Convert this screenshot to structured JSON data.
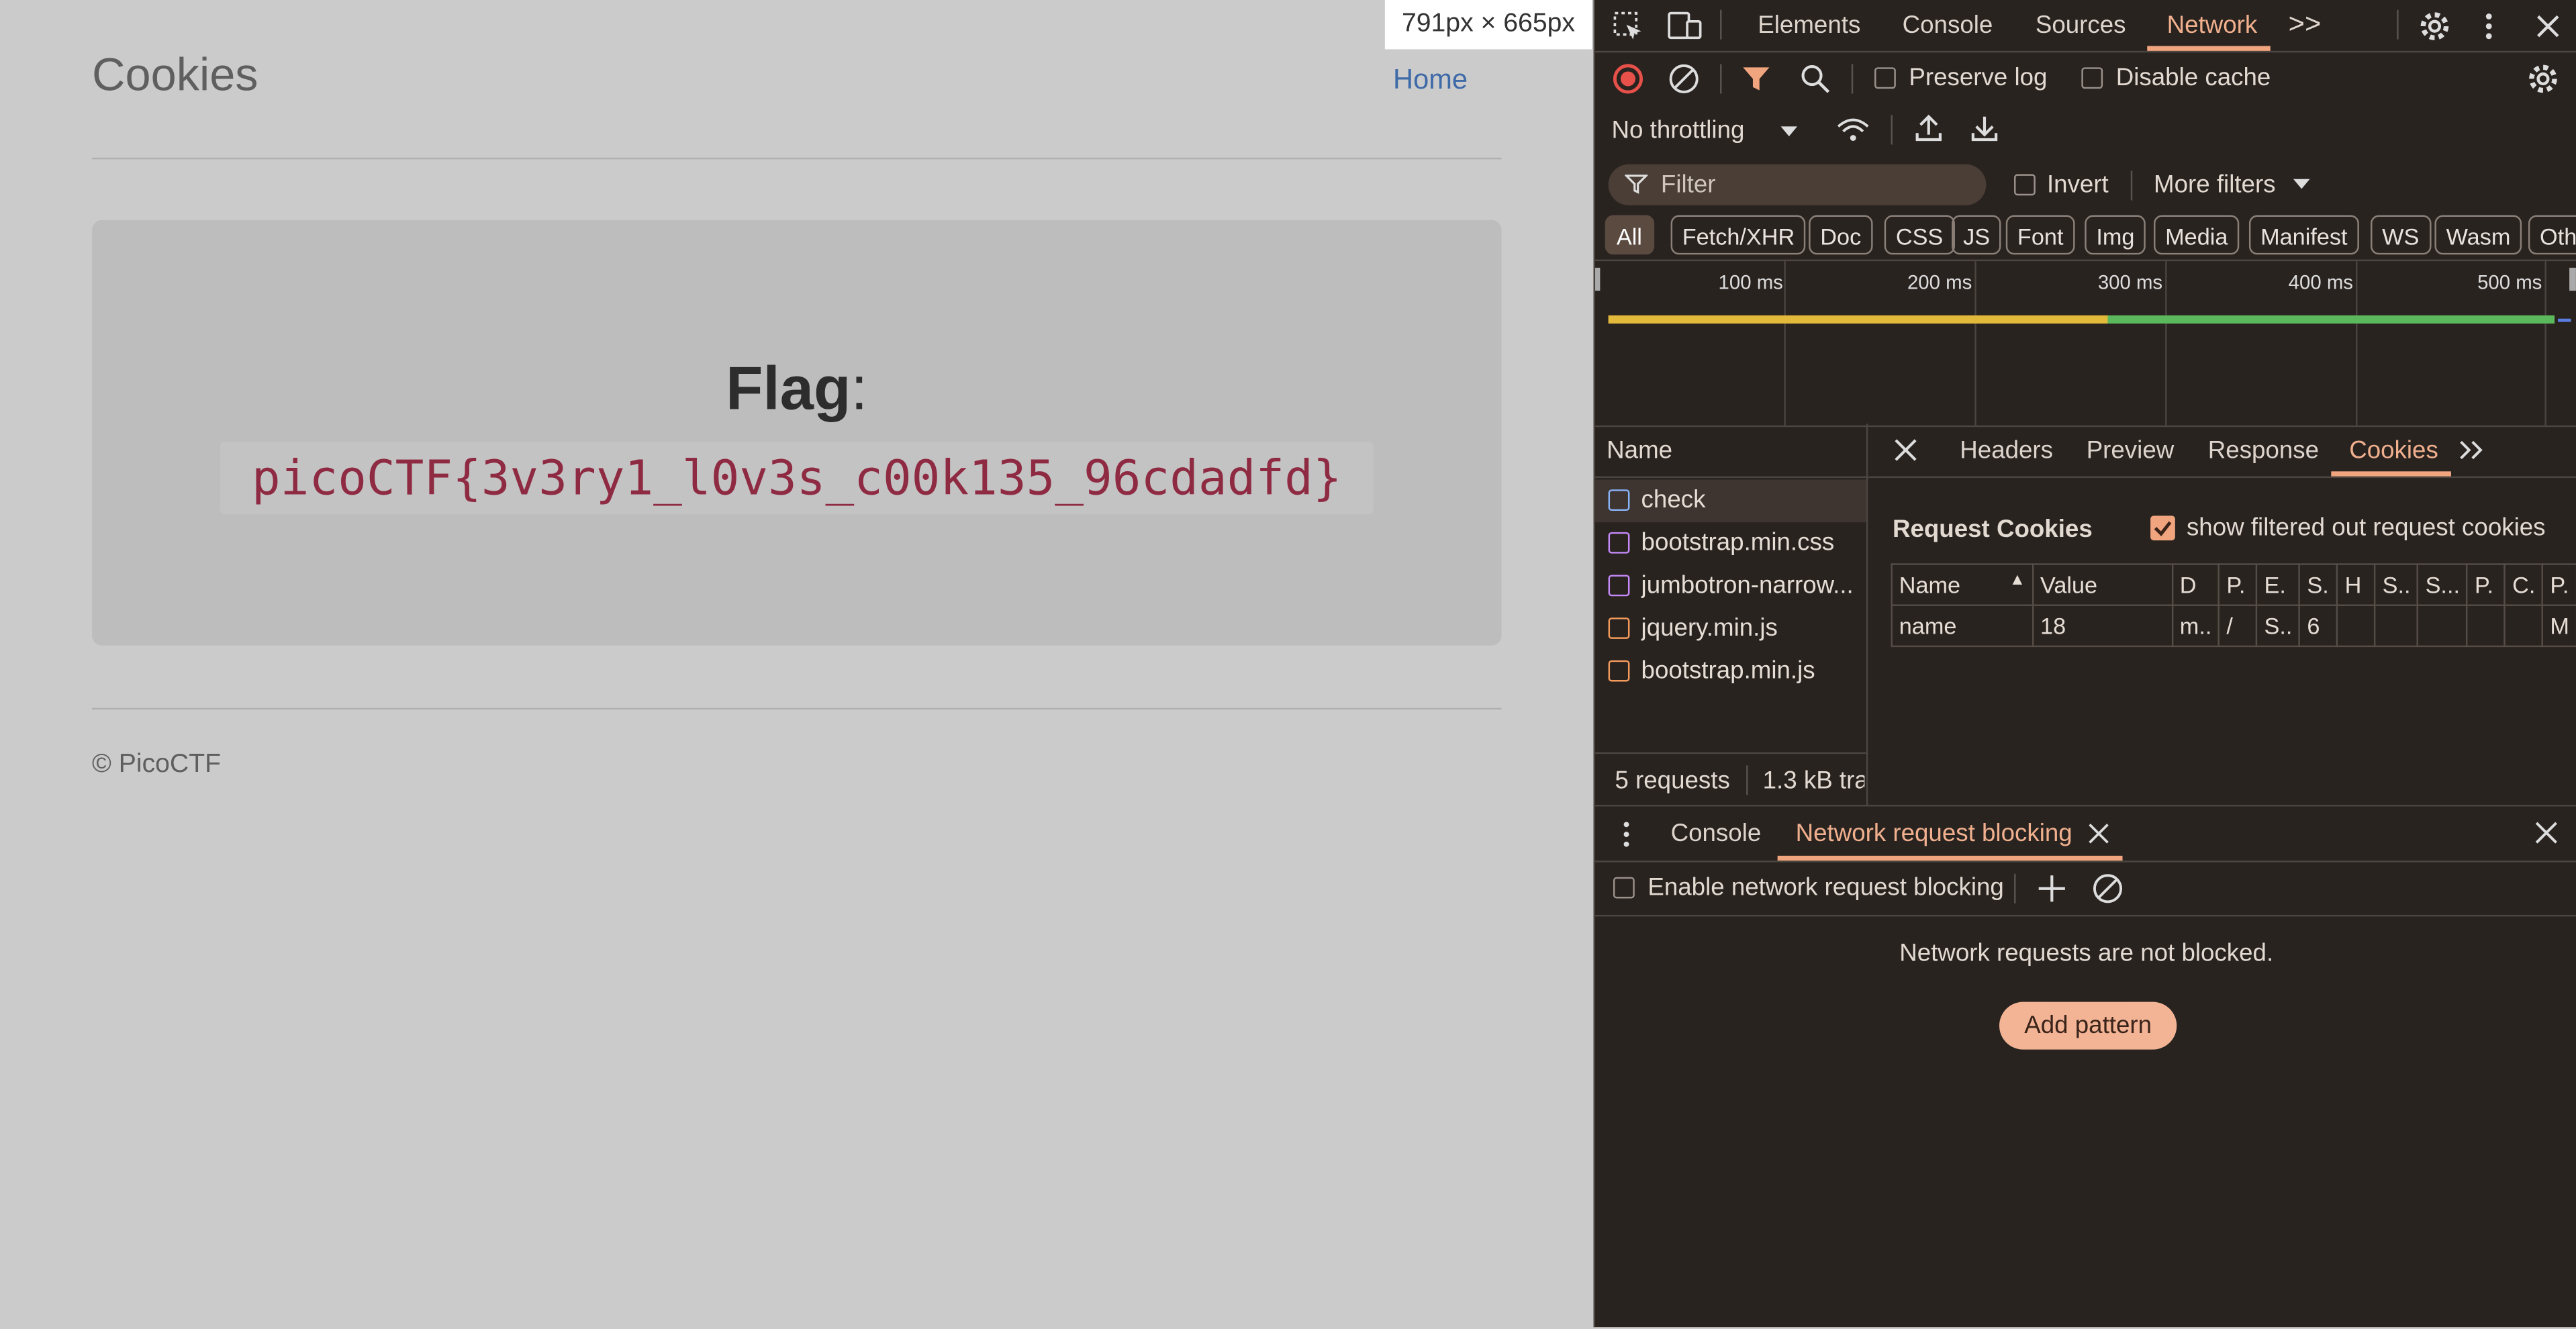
{
  "page": {
    "site_title": "Cookies",
    "home_link": "Home",
    "flag_label": "Flag",
    "flag_colon": ":",
    "flag_value": "picoCTF{3v3ry1_l0v3s_c00k135_96cdadfd}",
    "footer": "© PicoCTF",
    "viewport_badge": "791px × 665px"
  },
  "devtools": {
    "tabs": [
      "Elements",
      "Console",
      "Sources",
      "Network"
    ],
    "active_tab": "Network",
    "more_tabs": ">>",
    "toolbar": {
      "preserve_log": "Preserve log",
      "disable_cache": "Disable cache",
      "throttling": "No throttling"
    },
    "filter": {
      "placeholder": "Filter",
      "invert": "Invert",
      "more_filters": "More filters"
    },
    "type_chips": [
      "All",
      "Fetch/XHR",
      "Doc",
      "CSS",
      "JS",
      "Font",
      "Img",
      "Media",
      "Manifest",
      "WS",
      "Wasm",
      "Oth"
    ],
    "active_chip": "All",
    "timeline_ticks": [
      "100 ms",
      "200 ms",
      "300 ms",
      "400 ms",
      "500 ms"
    ],
    "name_header": "Name",
    "requests": [
      {
        "name": "check",
        "icon": "document-icon",
        "color": "#8ab4f8"
      },
      {
        "name": "bootstrap.min.css",
        "icon": "stylesheet-icon",
        "color": "#c58af9"
      },
      {
        "name": "jumbotron-narrow...",
        "icon": "stylesheet-icon",
        "color": "#c58af9"
      },
      {
        "name": "jquery.min.js",
        "icon": "script-icon",
        "color": "#f29a5c"
      },
      {
        "name": "bootstrap.min.js",
        "icon": "script-icon",
        "color": "#f29a5c"
      }
    ],
    "status": {
      "requests": "5 requests",
      "transferred": "1.3 kB tra"
    },
    "detail_tabs": [
      "Headers",
      "Preview",
      "Response",
      "Cookies"
    ],
    "detail_active": "Cookies",
    "request_cookies_title": "Request Cookies",
    "show_filtered": "show filtered out request cookies",
    "cookie_headers": [
      "Name",
      "Value",
      "D",
      "P.",
      "E.",
      "S.",
      "H",
      "S..",
      "S...",
      "P.",
      "C.",
      "P."
    ],
    "cookie_row": [
      "name",
      "18",
      "m..",
      "/",
      "S..",
      "6",
      "",
      "",
      "",
      "",
      "",
      "M"
    ],
    "drawer": {
      "tabs": [
        "Console",
        "Network request blocking"
      ],
      "enable_blocking": "Enable network request blocking",
      "empty_message": "Network requests are not blocked.",
      "add_pattern": "Add pattern"
    },
    "colors": {
      "accent": "#f0a57f",
      "panel_bg": "#292320",
      "timeline_yellow": "#e2b93b",
      "timeline_green": "#5cb85c"
    }
  }
}
